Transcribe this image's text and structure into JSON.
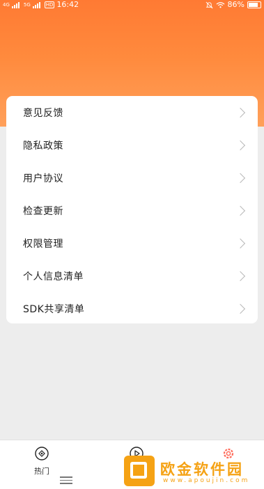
{
  "status_bar": {
    "net1": "4G",
    "net2": "5G",
    "hd": "HD",
    "time": "16:42",
    "battery": "86%"
  },
  "menu": {
    "items": [
      {
        "label": "意见反馈"
      },
      {
        "label": "隐私政策"
      },
      {
        "label": "用户协议"
      },
      {
        "label": "检查更新"
      },
      {
        "label": "权限管理"
      },
      {
        "label": "个人信息清单"
      },
      {
        "label": "SDK共享清单"
      }
    ]
  },
  "tabbar": {
    "hot_label": "热门"
  },
  "watermark": {
    "title": "欧金软件园",
    "url": "www.apoujin.com"
  },
  "colors": {
    "header_gradient_top": "#ff7a33",
    "header_gradient_bottom": "#ffa05a",
    "watermark": "#f5a214"
  },
  "icons": [
    "bell-mute-icon",
    "wifi-icon",
    "battery-icon",
    "compass-icon",
    "play-icon",
    "gear-icon",
    "chevron-right-icon"
  ]
}
